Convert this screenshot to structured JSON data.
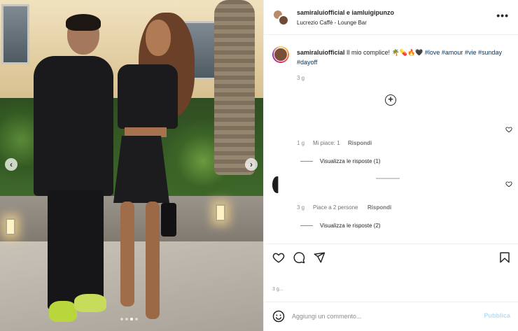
{
  "header": {
    "names": "samiraluiofficial e iamluigipunzo",
    "location": "Lucrezio Caffè - Lounge Bar",
    "more_label": "•••"
  },
  "caption": {
    "username": "samiraluiofficial",
    "text": " Il mio complice! 🌴💊🔥🖤 ",
    "hashtags": [
      "#love",
      "#amour",
      "#vie",
      "#sunday",
      "#dayoff"
    ],
    "time": "3 g"
  },
  "comments": [
    {
      "time": "1 g",
      "likes": "Mi piace: 1",
      "reply": "Rispondi",
      "view_replies": "Visualizza le risposte (1)"
    },
    {
      "time": "3 g",
      "likes": "Piace a 2 persone",
      "reply": "Rispondi",
      "view_replies": "Visualizza le risposte (2)"
    }
  ],
  "media": {
    "prev_label": "‹",
    "next_label": "›"
  },
  "footer": {
    "time_partial": "3 g...",
    "comment_placeholder": "Aggiungi un commento...",
    "publish_label": "Pubblica"
  },
  "colors": {
    "hashtag": "#00376b",
    "publish": "#b2dffc",
    "muted": "#8e8e8e"
  }
}
